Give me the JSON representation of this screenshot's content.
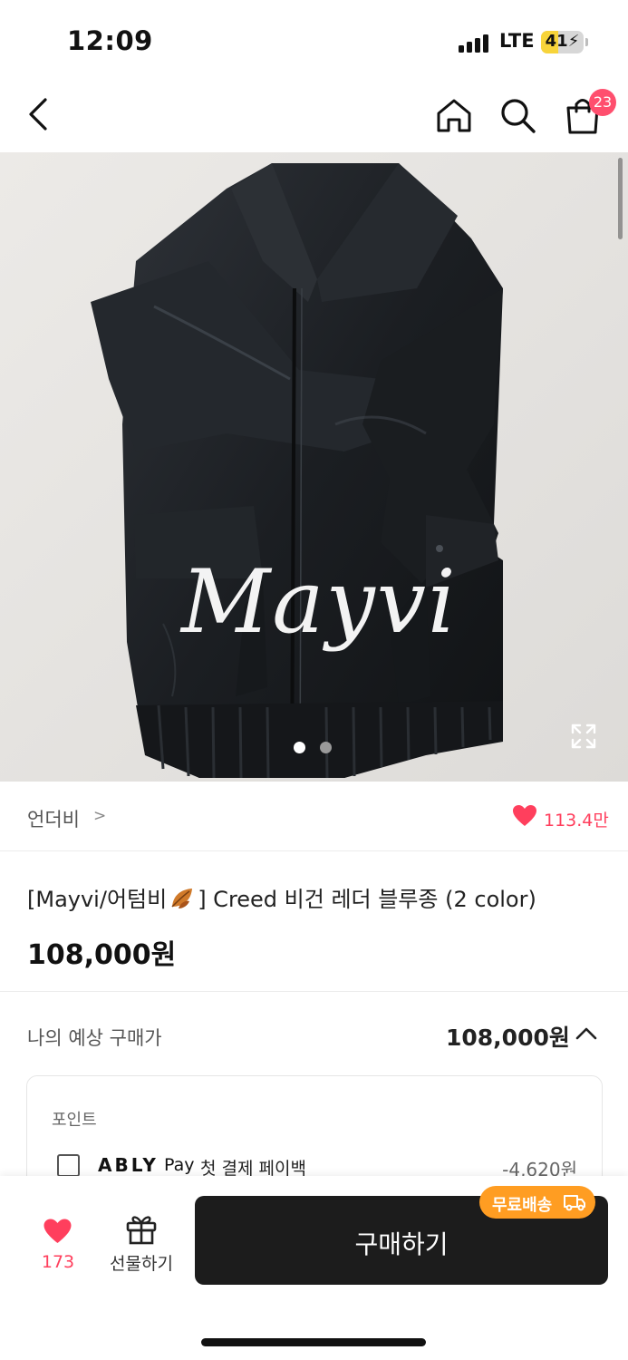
{
  "status_bar": {
    "time": "12:09",
    "network": "LTE",
    "battery": "41",
    "battery_level": 0.41
  },
  "nav": {
    "back_icon": "chevron-left-icon",
    "home_icon": "home-icon",
    "search_icon": "search-icon",
    "cart_icon": "shopping-bag-icon",
    "cart_count": "23"
  },
  "hero": {
    "watermark": "Mayvi",
    "slide_count": 2,
    "current_slide": 1,
    "expand_icon": "expand-icon"
  },
  "brand": {
    "name": "언더비",
    "arrow": ">",
    "like_count": "113.4만"
  },
  "product": {
    "title_prefix": "[Mayvi/어텀비",
    "title_suffix": "]  Creed 비건 레더 블루종 (2 color)",
    "price": "108,000원"
  },
  "expected_price": {
    "label": "나의 예상 구매가",
    "value": "108,000원"
  },
  "points": {
    "title": "포인트",
    "ably": "ABLY",
    "pay": "Pay",
    "payback_label": "첫 결제 페이백",
    "payback_value": "-4,620원"
  },
  "bottom": {
    "wish_count": "173",
    "gift_label": "선물하기",
    "buy_label": "구매하기",
    "free_shipping": "무료배송"
  },
  "colors": {
    "accent_red": "#ff3f5d",
    "badge_pink": "#ff4f6e",
    "shipping_orange": "#ff9d22",
    "buy_button": "#1c1c1c"
  }
}
